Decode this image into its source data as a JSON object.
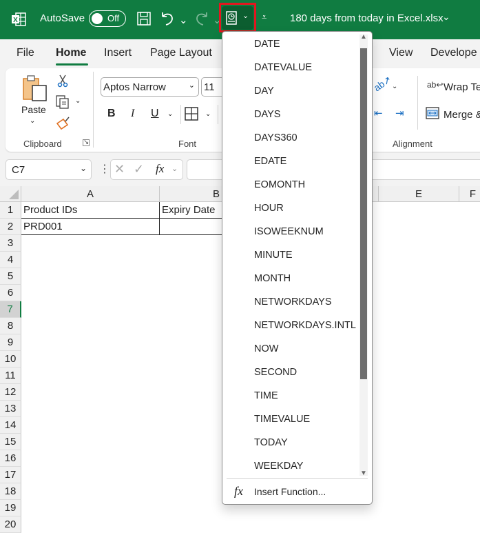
{
  "titlebar": {
    "app_icon": "excel-icon",
    "autosave_label": "AutoSave",
    "autosave_state": "Off",
    "filename": "180 days from today in Excel.xlsx",
    "save_icon": "save-icon",
    "undo_icon": "undo-icon",
    "redo_icon": "redo-icon",
    "datetime_functions_icon": "datetime-functions-icon",
    "customize_qat_icon": "customize-quick-access-icon"
  },
  "ribbon_tabs": [
    "File",
    "Home",
    "Insert",
    "Page Layout",
    "View",
    "Develope"
  ],
  "ribbon": {
    "clipboard": {
      "paste_label": "Paste",
      "group_label": "Clipboard"
    },
    "font": {
      "font_name": "Aptos Narrow",
      "font_size": "11",
      "group_label": "Font",
      "bold": "B",
      "italic": "I",
      "underline": "U"
    },
    "alignment": {
      "wrap_text": "Wrap Te",
      "merge": "Merge &",
      "group_label": "Alignment"
    }
  },
  "formula_bar": {
    "name_box": "C7",
    "fx": "fx",
    "formula": ""
  },
  "columns": [
    "A",
    "B",
    "E",
    "F"
  ],
  "rows": [
    "1",
    "2",
    "3",
    "4",
    "5",
    "6",
    "7",
    "8",
    "9",
    "10",
    "11",
    "12",
    "13",
    "14",
    "15",
    "16",
    "17",
    "18",
    "19",
    "20"
  ],
  "selected_row": "7",
  "cells": {
    "A1": "Product IDs",
    "B1": "Expiry Date",
    "A2": "PRD001"
  },
  "dropdown": {
    "items": [
      "DATE",
      "DATEVALUE",
      "DAY",
      "DAYS",
      "DAYS360",
      "EDATE",
      "EOMONTH",
      "HOUR",
      "ISOWEEKNUM",
      "MINUTE",
      "MONTH",
      "NETWORKDAYS",
      "NETWORKDAYS.INTL",
      "NOW",
      "SECOND",
      "TIME",
      "TIMEVALUE",
      "TODAY",
      "WEEKDAY"
    ],
    "insert_function": "Insert Function...",
    "fx": "fx"
  },
  "colors": {
    "excel_green": "#107c41",
    "highlight_red": "#e3161f"
  }
}
